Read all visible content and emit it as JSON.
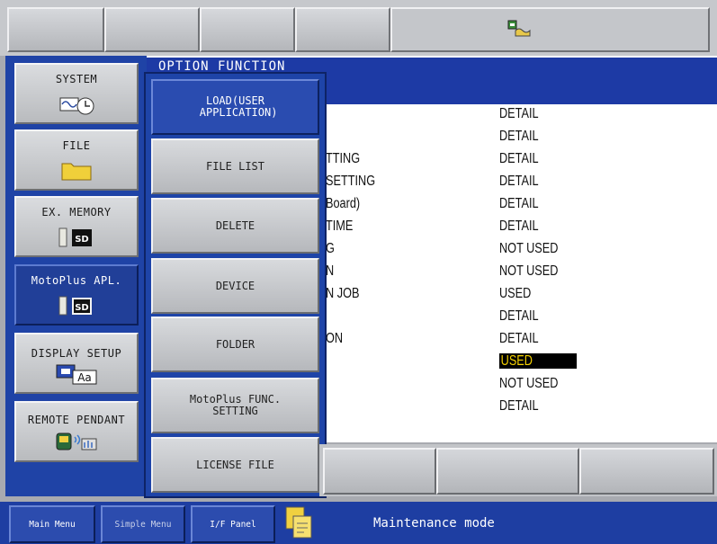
{
  "window_title": "OPTION FUNCTION",
  "main_menu": [
    {
      "label": "SYSTEM",
      "icon": "system-clock-icon"
    },
    {
      "label": "FILE",
      "icon": "folder-icon"
    },
    {
      "label": "EX. MEMORY",
      "icon": "sd-card-icon"
    },
    {
      "label": "MotoPlus APL.",
      "icon": "sd-card-icon",
      "active": true
    },
    {
      "label": "DISPLAY SETUP",
      "icon": "display-font-icon"
    },
    {
      "label": "REMOTE PENDANT",
      "icon": "remote-pendant-icon"
    }
  ],
  "sub_menu": [
    {
      "label": "LOAD(USER\n APPLICATION)",
      "active": true
    },
    {
      "label": "FILE LIST"
    },
    {
      "label": "DELETE"
    },
    {
      "label": "DEVICE"
    },
    {
      "label": "FOLDER"
    },
    {
      "label": "MotoPlus FUNC.\nSETTING"
    },
    {
      "label": "LICENSE FILE"
    }
  ],
  "option_rows_left_fragments": [
    "",
    "",
    "TTING",
    "SETTING",
    "Board)",
    "TIME",
    "G",
    "N",
    "N JOB",
    "",
    "ON",
    "",
    "",
    ""
  ],
  "option_rows_values": [
    "DETAIL",
    "DETAIL",
    "DETAIL",
    "DETAIL",
    "DETAIL",
    "DETAIL",
    "NOT USED",
    "NOT USED",
    "USED",
    "DETAIL",
    "DETAIL",
    "USED",
    "NOT USED",
    "DETAIL"
  ],
  "selected_row_index": 11,
  "bottom_bar": {
    "main_menu": "Main Menu",
    "simple_menu": "Simple Menu",
    "if_panel": "I/F Panel",
    "status": "Maintenance mode"
  },
  "colors": {
    "menu_blue": "#1f43a6",
    "highlight_bg": "#000000",
    "highlight_text": "#f4d000"
  }
}
